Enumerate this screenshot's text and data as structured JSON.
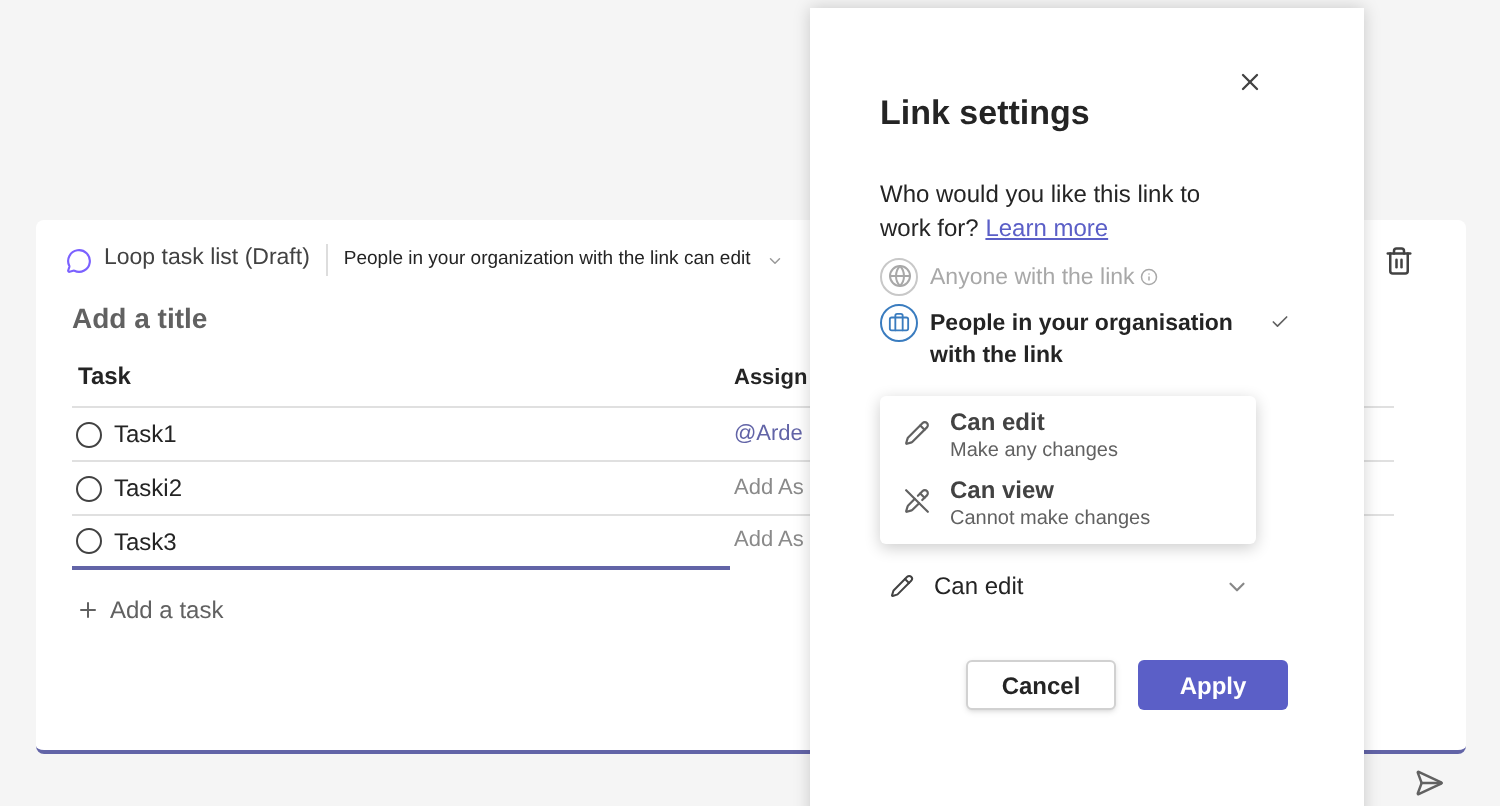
{
  "card": {
    "app_name": "Loop task list (Draft)",
    "permission": "People in your organization with the link can edit",
    "title_placeholder": "Add a title",
    "columns": [
      "Task",
      "Assign"
    ],
    "rows": [
      {
        "task": "Task1",
        "assignee": "@Arde",
        "assigned": true,
        "done": false
      },
      {
        "task": "Taski2",
        "assignee": "Add As",
        "assigned": false,
        "done": false
      },
      {
        "task": "Task3",
        "assignee": "Add As",
        "assigned": false,
        "done": false
      }
    ],
    "add_task": "Add a task"
  },
  "dialog": {
    "title": "Link settings",
    "question": "Who would you like this link to work for?",
    "link": "Learn more",
    "options": [
      {
        "label": "Anyone with the link",
        "kind": "globe",
        "disabled": true,
        "selected": false
      },
      {
        "label": "People in your organisation with the link",
        "kind": "briefcase",
        "disabled": false,
        "selected": true
      }
    ],
    "menu": [
      {
        "label": "Can edit",
        "sub": "Make any changes",
        "kind": "edit"
      },
      {
        "label": "Can view",
        "sub": "Cannot make changes",
        "kind": "view"
      }
    ],
    "permission_value": "Can edit",
    "buttons": [
      {
        "label": "Cancel",
        "primary": false
      },
      {
        "label": "Apply",
        "primary": true
      }
    ]
  }
}
